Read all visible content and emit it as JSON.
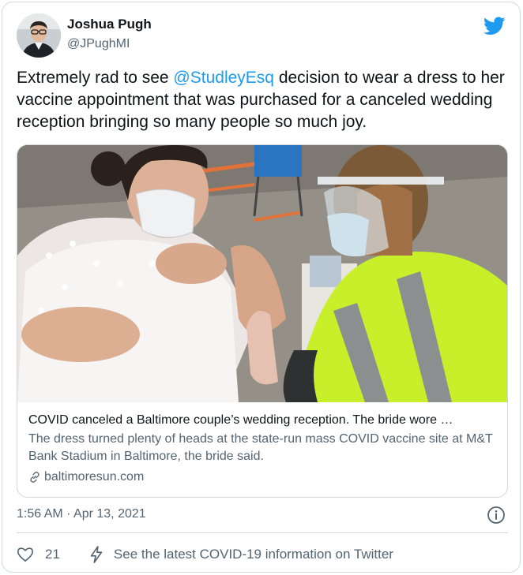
{
  "author": {
    "name": "Joshua Pugh",
    "handle": "@JPughMI",
    "avatar_icon": "user-avatar"
  },
  "tweet": {
    "text_before": "Extremely rad to see ",
    "mention": "@StudleyEsq",
    "text_after": " decision to wear a dress to her vaccine appointment that was purchased for a canceled wedding reception bringing so many people so much joy."
  },
  "card": {
    "title": "COVID canceled a Baltimore couple’s wedding reception. The bride wore …",
    "description": "The dress turned plenty of heads at the state-run mass COVID vaccine site at M&T Bank Stadium in Baltimore, the bride said.",
    "domain": "baltimoresun.com",
    "image_icon": "photo"
  },
  "meta": {
    "timestamp": "1:56 AM · Apr 13, 2021"
  },
  "actions": {
    "like_count": "21",
    "covid_info": "See the latest COVID-19 information on Twitter"
  },
  "colors": {
    "accent": "#1d9bf0",
    "text": "#0f1419",
    "muted": "#536471",
    "border": "#cfd9de",
    "vest": "#c8f02a"
  }
}
